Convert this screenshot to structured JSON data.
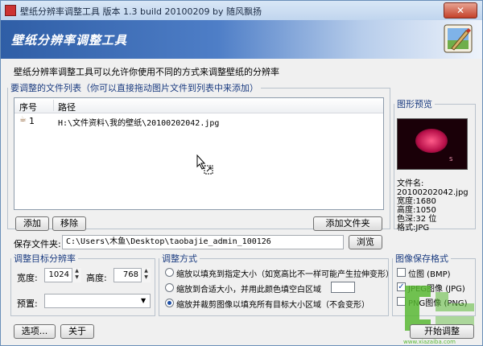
{
  "window": {
    "title": "壁纸分辨率调整工具 版本 1.3 build 20100209 by 随风飘扬",
    "close_glyph": "✕"
  },
  "banner": {
    "title": "壁纸分辨率调整工具"
  },
  "description": "壁纸分辨率调整工具可以允许你使用不同的方式来调整壁纸的分辨率",
  "file_list": {
    "legend": "要调整的文件列表（你可以直接拖动图片文件到列表中来添加）",
    "columns": [
      "序号",
      "路径"
    ],
    "rows": [
      {
        "index": "1",
        "path": "H:\\文件资料\\我的壁纸\\20100202042.jpg"
      }
    ],
    "add_label": "添加",
    "remove_label": "移除",
    "add_folder_label": "添加文件夹"
  },
  "preview": {
    "title": "图形预览",
    "thumb_text": "S",
    "info_lines": [
      "文件名:",
      "20100202042.jpg",
      "宽度:1680",
      "高度:1050",
      "色深:32 位",
      "格式:JPG"
    ]
  },
  "save_folder": {
    "label": "保存文件夹:",
    "value": "C:\\Users\\木鱼\\Desktop\\taobajie_admin_100126",
    "browse_label": "浏览"
  },
  "target_res": {
    "legend": "调整目标分辨率",
    "width_label": "宽度:",
    "width_value": "1024",
    "height_label": "高度:",
    "height_value": "768",
    "preset_label": "预置:",
    "preset_value": ""
  },
  "adjust_mode": {
    "legend": "调整方式",
    "options": [
      "缩放以填充到指定大小（如宽高比不一样可能产生拉伸变形）",
      "缩放到合适大小，并用此颜色填空白区域",
      "缩放并裁剪图像以填充所有目标大小区域（不会变形）"
    ],
    "selected": 2
  },
  "save_format": {
    "legend": "图像保存格式",
    "options": [
      {
        "label": "位图 (BMP)",
        "checked": false
      },
      {
        "label": "JPEG图像 (JPG)",
        "checked": true
      },
      {
        "label": "PNG图像 (PNG)",
        "checked": false
      }
    ]
  },
  "footer": {
    "options_label": "选项...",
    "about_label": "关于",
    "start_label": "开始调整"
  },
  "watermark": {
    "text": "www.xiazaiba.com"
  },
  "colors": {
    "banner_start": "#2f5ea6",
    "accent": "#1e4fa6"
  }
}
